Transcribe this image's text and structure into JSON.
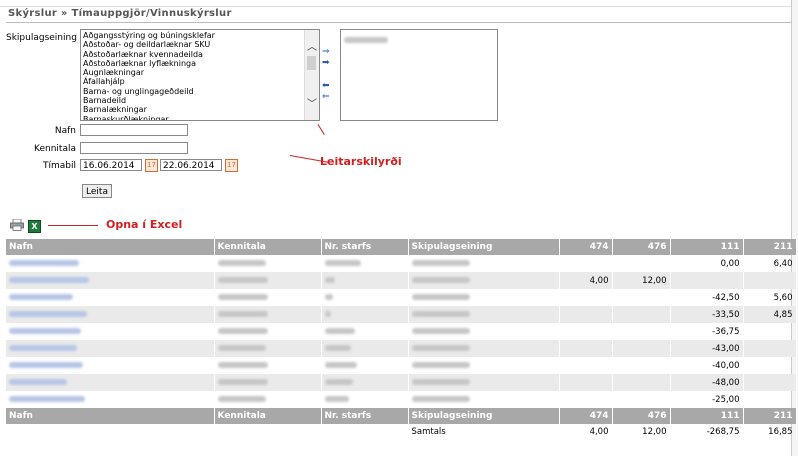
{
  "breadcrumb": "Skýrslur » Tímauppgjör/Vinnuskýrslur",
  "form": {
    "skipulag_label": "Skipulagseining",
    "units": [
      "Aðgangsstýring og búningsklefar",
      "Aðstoðar- og deildarlæknar SKU",
      "Aðstoðarlæknar kvennadeilda",
      "Aðstoðarlæknar lyflækninga",
      "Augnlækningar",
      "Áfallahjálp",
      "Barna- og unglingageðdeild",
      "Barnadeild",
      "Barnalækningar",
      "Barnaskurðlækningar"
    ],
    "nafn_label": "Nafn",
    "kennitala_label": "Kennitala",
    "timabil_label": "Tímabil",
    "date_from": "16.06.2014",
    "date_to": "22.06.2014",
    "search_button": "Leita"
  },
  "annotations": {
    "search_criteria": "Leitarskilyrði",
    "open_excel": "Opna í Excel"
  },
  "table": {
    "headers": [
      "Nafn",
      "Kennitala",
      "Nr. starfs",
      "Skipulagseining",
      "474",
      "476",
      "111",
      "211"
    ],
    "rows": [
      {
        "c474": "",
        "c476": "",
        "c111": "0,00",
        "c211": "6,40"
      },
      {
        "c474": "4,00",
        "c476": "12,00",
        "c111": "",
        "c211": ""
      },
      {
        "c474": "",
        "c476": "",
        "c111": "-42,50",
        "c211": "5,60"
      },
      {
        "c474": "",
        "c476": "",
        "c111": "-33,50",
        "c211": "4,85"
      },
      {
        "c474": "",
        "c476": "",
        "c111": "-36,75",
        "c211": ""
      },
      {
        "c474": "",
        "c476": "",
        "c111": "-43,00",
        "c211": ""
      },
      {
        "c474": "",
        "c476": "",
        "c111": "-40,00",
        "c211": ""
      },
      {
        "c474": "",
        "c476": "",
        "c111": "-48,00",
        "c211": ""
      },
      {
        "c474": "",
        "c476": "",
        "c111": "-25,00",
        "c211": ""
      }
    ],
    "totals_label": "Samtals",
    "totals": {
      "c474": "4,00",
      "c476": "12,00",
      "c111": "-268,75",
      "c211": "16,85"
    }
  }
}
